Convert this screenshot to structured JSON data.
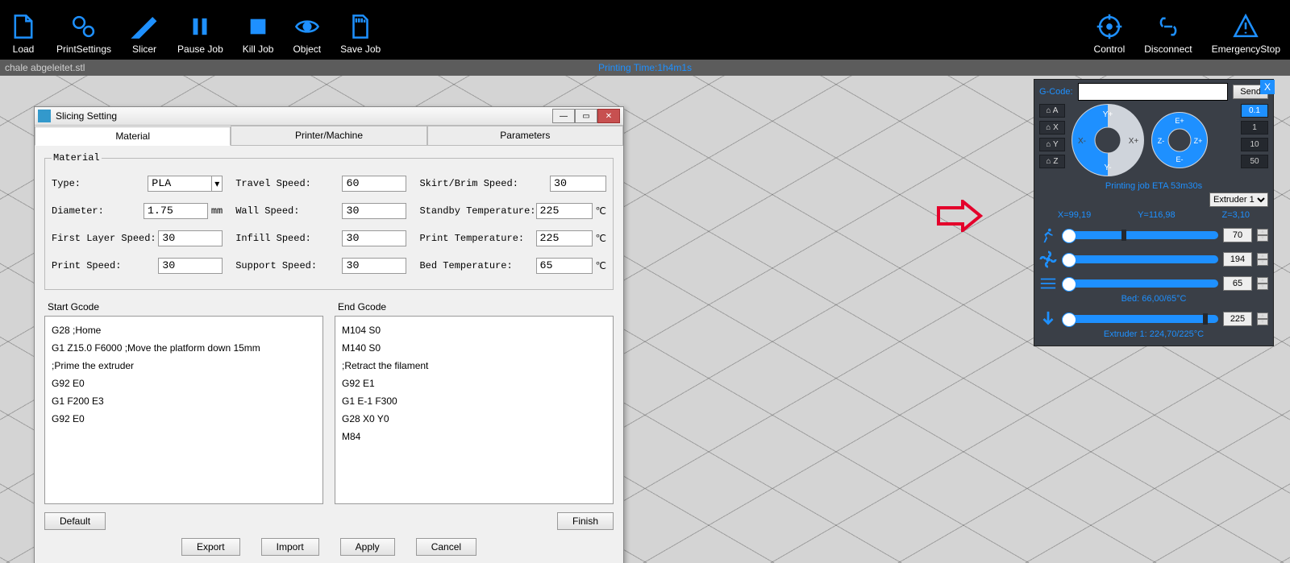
{
  "toolbar": {
    "load": "Load",
    "printSettings": "PrintSettings",
    "slicer": "Slicer",
    "pauseJob": "Pause Job",
    "killJob": "Kill Job",
    "object": "Object",
    "saveJob": "Save Job",
    "control": "Control",
    "disconnect": "Disconnect",
    "emergencyStop": "EmergencyStop"
  },
  "filestrip": {
    "filename": "chale abgeleitet.stl",
    "printTime": "Printing Time:1h4m1s"
  },
  "dialog": {
    "title": "Slicing Setting",
    "tabs": {
      "material": "Material",
      "printer": "Printer/Machine",
      "parameters": "Parameters"
    },
    "group": "Material",
    "fields": {
      "typeLabel": "Type:",
      "typeValue": "PLA",
      "diameterLabel": "Diameter:",
      "diameterValue": "1.75",
      "diameterUnit": "mm",
      "firstLayerSpeedLabel": "First Layer Speed:",
      "firstLayerSpeedValue": "30",
      "printSpeedLabel": "Print Speed:",
      "printSpeedValue": "30",
      "travelSpeedLabel": "Travel Speed:",
      "travelSpeedValue": "60",
      "wallSpeedLabel": "Wall Speed:",
      "wallSpeedValue": "30",
      "infillSpeedLabel": "Infill Speed:",
      "infillSpeedValue": "30",
      "supportSpeedLabel": "Support Speed:",
      "supportSpeedValue": "30",
      "skirtBrimSpeedLabel": "Skirt/Brim Speed:",
      "skirtBrimSpeedValue": "30",
      "standbyTempLabel": "Standby Temperature:",
      "standbyTempValue": "225",
      "tempUnit": "℃",
      "printTempLabel": "Print Temperature:",
      "printTempValue": "225",
      "bedTempLabel": "Bed Temperature:",
      "bedTempValue": "65"
    },
    "startGcode": {
      "label": "Start Gcode",
      "text": "G28 ;Home\nG1 Z15.0 F6000 ;Move the platform down 15mm\n;Prime the extruder\nG92 E0\nG1 F200 E3\nG92 E0"
    },
    "endGcode": {
      "label": "End Gcode",
      "text": "M104 S0\nM140 S0\n;Retract the filament\nG92 E1\nG1 E-1 F300\nG28 X0 Y0\nM84"
    },
    "buttons": {
      "default": "Default",
      "finish": "Finish",
      "export": "Export",
      "import": "Import",
      "apply": "Apply",
      "cancel": "Cancel"
    }
  },
  "control": {
    "gcodeLabel": "G-Code:",
    "send": "Send",
    "homeA": "⌂ A",
    "homeX": "⌂ X",
    "homeY": "⌂ Y",
    "homeZ": "⌂ Z",
    "stepButtons": {
      "s01": "0.1",
      "s1": "1",
      "s10": "10",
      "s50": "50"
    },
    "jog": {
      "yp": "Y+",
      "ym": "Y-",
      "xp": "X+",
      "xm": "X-",
      "zp": "Z+",
      "zm": "Z-",
      "ep": "E+",
      "em": "E-"
    },
    "eta": "Printing job ETA 53m30s",
    "coords": {
      "x": "X=99,19",
      "y": "Y=116,98",
      "z": "Z=3,10"
    },
    "extruderSelect": "Extruder 1",
    "sliders": {
      "speed": {
        "value": "70"
      },
      "fan": {
        "value": "194"
      },
      "bed": {
        "value": "65",
        "label": "Bed: 66,00/65°C"
      },
      "ext": {
        "value": "225",
        "label": "Extruder 1: 224,70/225°C"
      }
    }
  }
}
